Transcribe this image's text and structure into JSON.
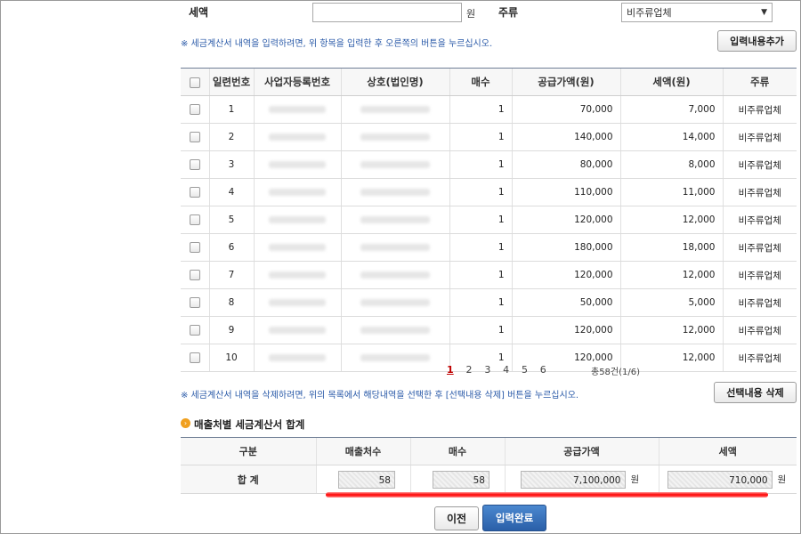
{
  "top_form": {
    "tax_label": "세액",
    "tax_value": "",
    "won_unit": "원",
    "type_label": "주류",
    "type_selected": "비주류업체",
    "notice_add": "※ 세금계산서 내역을 입력하려면, 위 항목을 입력한 후 오른쪽의 버튼을 누르십시오.",
    "add_button": "입력내용추가"
  },
  "table": {
    "headers": [
      "일련번호",
      "사업자등록번호",
      "상호(법인명)",
      "매수",
      "공급가액(원)",
      "세액(원)",
      "주류"
    ],
    "rows": [
      {
        "no": "1",
        "count": "1",
        "supply": "70,000",
        "tax": "7,000",
        "type": "비주류업체"
      },
      {
        "no": "2",
        "count": "1",
        "supply": "140,000",
        "tax": "14,000",
        "type": "비주류업체"
      },
      {
        "no": "3",
        "count": "1",
        "supply": "80,000",
        "tax": "8,000",
        "type": "비주류업체"
      },
      {
        "no": "4",
        "count": "1",
        "supply": "110,000",
        "tax": "11,000",
        "type": "비주류업체"
      },
      {
        "no": "5",
        "count": "1",
        "supply": "120,000",
        "tax": "12,000",
        "type": "비주류업체"
      },
      {
        "no": "6",
        "count": "1",
        "supply": "180,000",
        "tax": "18,000",
        "type": "비주류업체"
      },
      {
        "no": "7",
        "count": "1",
        "supply": "120,000",
        "tax": "12,000",
        "type": "비주류업체"
      },
      {
        "no": "8",
        "count": "1",
        "supply": "50,000",
        "tax": "5,000",
        "type": "비주류업체"
      },
      {
        "no": "9",
        "count": "1",
        "supply": "120,000",
        "tax": "12,000",
        "type": "비주류업체"
      },
      {
        "no": "10",
        "count": "1",
        "supply": "120,000",
        "tax": "12,000",
        "type": "비주류업체"
      }
    ]
  },
  "pagination": {
    "pages": [
      "1",
      "2",
      "3",
      "4",
      "5",
      "6"
    ],
    "current": "1",
    "total": "총58건(1/6)"
  },
  "delete_section": {
    "notice": "※ 세금계산서 내역을 삭제하려면, 위의 목록에서 해당내역을 선택한 후 [선택내용 삭제] 버튼을 누르십시오.",
    "delete_button": "선택내용 삭제"
  },
  "summary": {
    "title": "매출처별 세금계산서 합계",
    "headers": [
      "구분",
      "매출처수",
      "매수",
      "공급가액",
      "세액"
    ],
    "row_label": "합 계",
    "sellers": "58",
    "count": "58",
    "supply": "7,100,000",
    "supply_unit": "원",
    "tax": "710,000",
    "tax_unit": "원"
  },
  "footer": {
    "prev_button": "이전",
    "done_button": "입력완료"
  },
  "colors": {
    "accent_blue": "#2f6db7",
    "header_border": "#6f7e95",
    "highlight_red": "#ff0000",
    "note_blue": "#2a5aa8"
  }
}
